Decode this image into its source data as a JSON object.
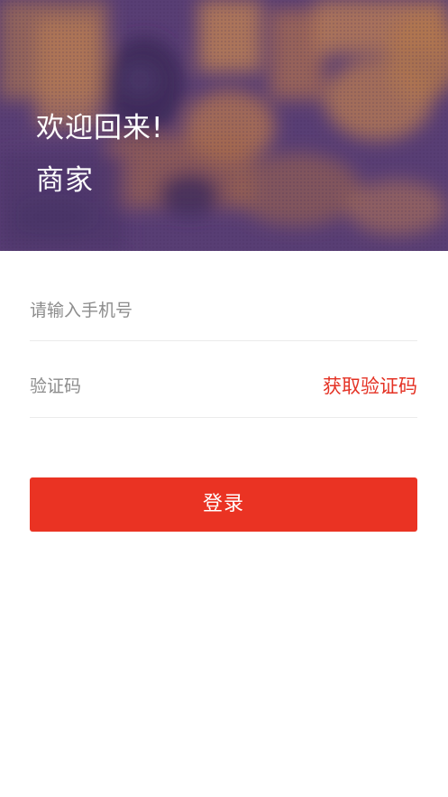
{
  "header": {
    "title": "欢迎回来!",
    "subtitle": "商家",
    "image_description": "duotone restaurant interior photo",
    "tint_colors": [
      "#5a3f73",
      "#c17a4a"
    ]
  },
  "form": {
    "phone": {
      "placeholder": "请输入手机号",
      "value": ""
    },
    "code": {
      "placeholder": "验证码",
      "value": "",
      "get_code_label": "获取验证码"
    },
    "login_label": "登录"
  },
  "colors": {
    "accent": "#ea3323",
    "link": "#e43224",
    "divider": "#ebebeb",
    "placeholder": "#8c8c8c"
  }
}
